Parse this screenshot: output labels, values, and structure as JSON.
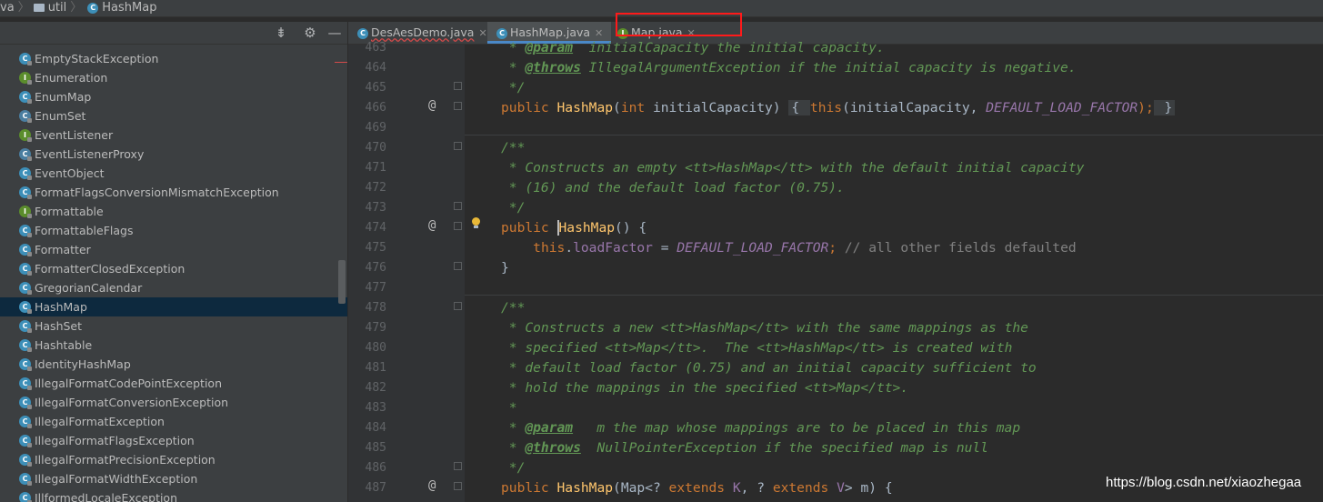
{
  "breadcrumb": {
    "part0": "va",
    "part1": "util",
    "part2": "HashMap"
  },
  "tree": {
    "items": [
      {
        "label": "EmptyStackException",
        "icon": "class"
      },
      {
        "label": "Enumeration",
        "icon": "interface"
      },
      {
        "label": "EnumMap",
        "icon": "class"
      },
      {
        "label": "EnumSet",
        "icon": "abstract-class"
      },
      {
        "label": "EventListener",
        "icon": "interface"
      },
      {
        "label": "EventListenerProxy",
        "icon": "abstract-class"
      },
      {
        "label": "EventObject",
        "icon": "class"
      },
      {
        "label": "FormatFlagsConversionMismatchException",
        "icon": "class"
      },
      {
        "label": "Formattable",
        "icon": "interface"
      },
      {
        "label": "FormattableFlags",
        "icon": "class"
      },
      {
        "label": "Formatter",
        "icon": "class"
      },
      {
        "label": "FormatterClosedException",
        "icon": "class"
      },
      {
        "label": "GregorianCalendar",
        "icon": "class"
      },
      {
        "label": "HashMap",
        "icon": "class",
        "selected": true
      },
      {
        "label": "HashSet",
        "icon": "class"
      },
      {
        "label": "Hashtable",
        "icon": "class"
      },
      {
        "label": "IdentityHashMap",
        "icon": "class"
      },
      {
        "label": "IllegalFormatCodePointException",
        "icon": "class"
      },
      {
        "label": "IllegalFormatConversionException",
        "icon": "class"
      },
      {
        "label": "IllegalFormatException",
        "icon": "class"
      },
      {
        "label": "IllegalFormatFlagsException",
        "icon": "class"
      },
      {
        "label": "IllegalFormatPrecisionException",
        "icon": "class"
      },
      {
        "label": "IllegalFormatWidthException",
        "icon": "class"
      },
      {
        "label": "IllformedLocaleException",
        "icon": "class"
      }
    ]
  },
  "tabs": [
    {
      "label": "DesAesDemo.java",
      "icon": "class",
      "active": false
    },
    {
      "label": "HashMap.java",
      "icon": "class",
      "active": true
    },
    {
      "label": "Map.java",
      "icon": "interface",
      "active": false
    }
  ],
  "editor": {
    "line_numbers": [
      "463",
      "464",
      "465",
      "466",
      "469",
      "470",
      "471",
      "472",
      "473",
      "474",
      "475",
      "476",
      "477",
      "478",
      "479",
      "480",
      "481",
      "482",
      "483",
      "484",
      "485",
      "486",
      "487"
    ],
    "lines": {
      "l463": {
        "a": " * ",
        "b": "@param",
        "c": "  initialCapacity the initial capacity."
      },
      "l464": {
        "a": " * ",
        "b": "@throws",
        "c": " IllegalArgumentException if the initial capacity is negative."
      },
      "l465": {
        "a": " */"
      },
      "l466": {
        "kw1": "public ",
        "fn": "HashMap",
        "p1": "(",
        "kw2": "int",
        "p2": " initialCapacity) ",
        "fb1": "{ ",
        "kw3": "this",
        "p3": "(initialCapacity, ",
        "cst": "DEFAULT_LOAD_FACTOR",
        "p4": ");",
        "fb2": " }"
      },
      "l470": {
        "a": "/**"
      },
      "l471": {
        "a": " * Constructs an empty ",
        "t1": "<tt>",
        "b": "HashMap",
        "t2": "</tt>",
        "c": " with the default initial capacity"
      },
      "l472": {
        "a": " * (16) and the default load factor (0.75)."
      },
      "l473": {
        "a": " */"
      },
      "l474": {
        "kw1": "public ",
        "fn": "HashMap",
        "p1": "() {"
      },
      "l475": {
        "pre": "    ",
        "kw": "this",
        "dot": ".",
        "fld": "loadFactor",
        "eq": " = ",
        "cst": "DEFAULT_LOAD_FACTOR",
        "semi": "; ",
        "lc": "// all other fields defaulted"
      },
      "l476": {
        "a": "}"
      },
      "l478": {
        "a": "/**"
      },
      "l479": {
        "a": " * Constructs a new ",
        "t1": "<tt>",
        "b": "HashMap",
        "t2": "</tt>",
        "c": " with the same mappings as the"
      },
      "l480": {
        "a": " * specified ",
        "t1": "<tt>",
        "b": "Map",
        "t2": "</tt>",
        "c": ".  The ",
        "t3": "<tt>",
        "d": "HashMap",
        "t4": "</tt>",
        "e": " is created with"
      },
      "l481": {
        "a": " * default load factor (0.75) and an initial capacity sufficient to"
      },
      "l482": {
        "a": " * hold the mappings in the specified ",
        "t1": "<tt>",
        "b": "Map",
        "t2": "</tt>",
        "c": "."
      },
      "l483": {
        "a": " *"
      },
      "l484": {
        "a": " * ",
        "b": "@param",
        "c": "   m the map whose mappings are to be placed in this map"
      },
      "l485": {
        "a": " * ",
        "b": "@throws",
        "c": "  NullPointerException if the specified map is null"
      },
      "l486": {
        "a": " */"
      },
      "l487": {
        "kw1": "public ",
        "fn": "HashMap",
        "p1": "(Map<? ",
        "kw2": "extends",
        "p2": " ",
        "g1": "K",
        "p3": ", ? ",
        "kw3": "extends",
        "p4": " ",
        "g2": "V",
        "p5": "> m) {"
      }
    }
  },
  "gutter_markers": {
    "override": "@"
  },
  "watermark": "https://blog.csdn.net/xiaozhegaa",
  "colors": {
    "accent": "#4a88c7",
    "highlight_box": "#ff1a1a",
    "keyword": "#cc7832",
    "comment": "#629755",
    "method": "#ffc66d",
    "constant": "#9876aa"
  }
}
